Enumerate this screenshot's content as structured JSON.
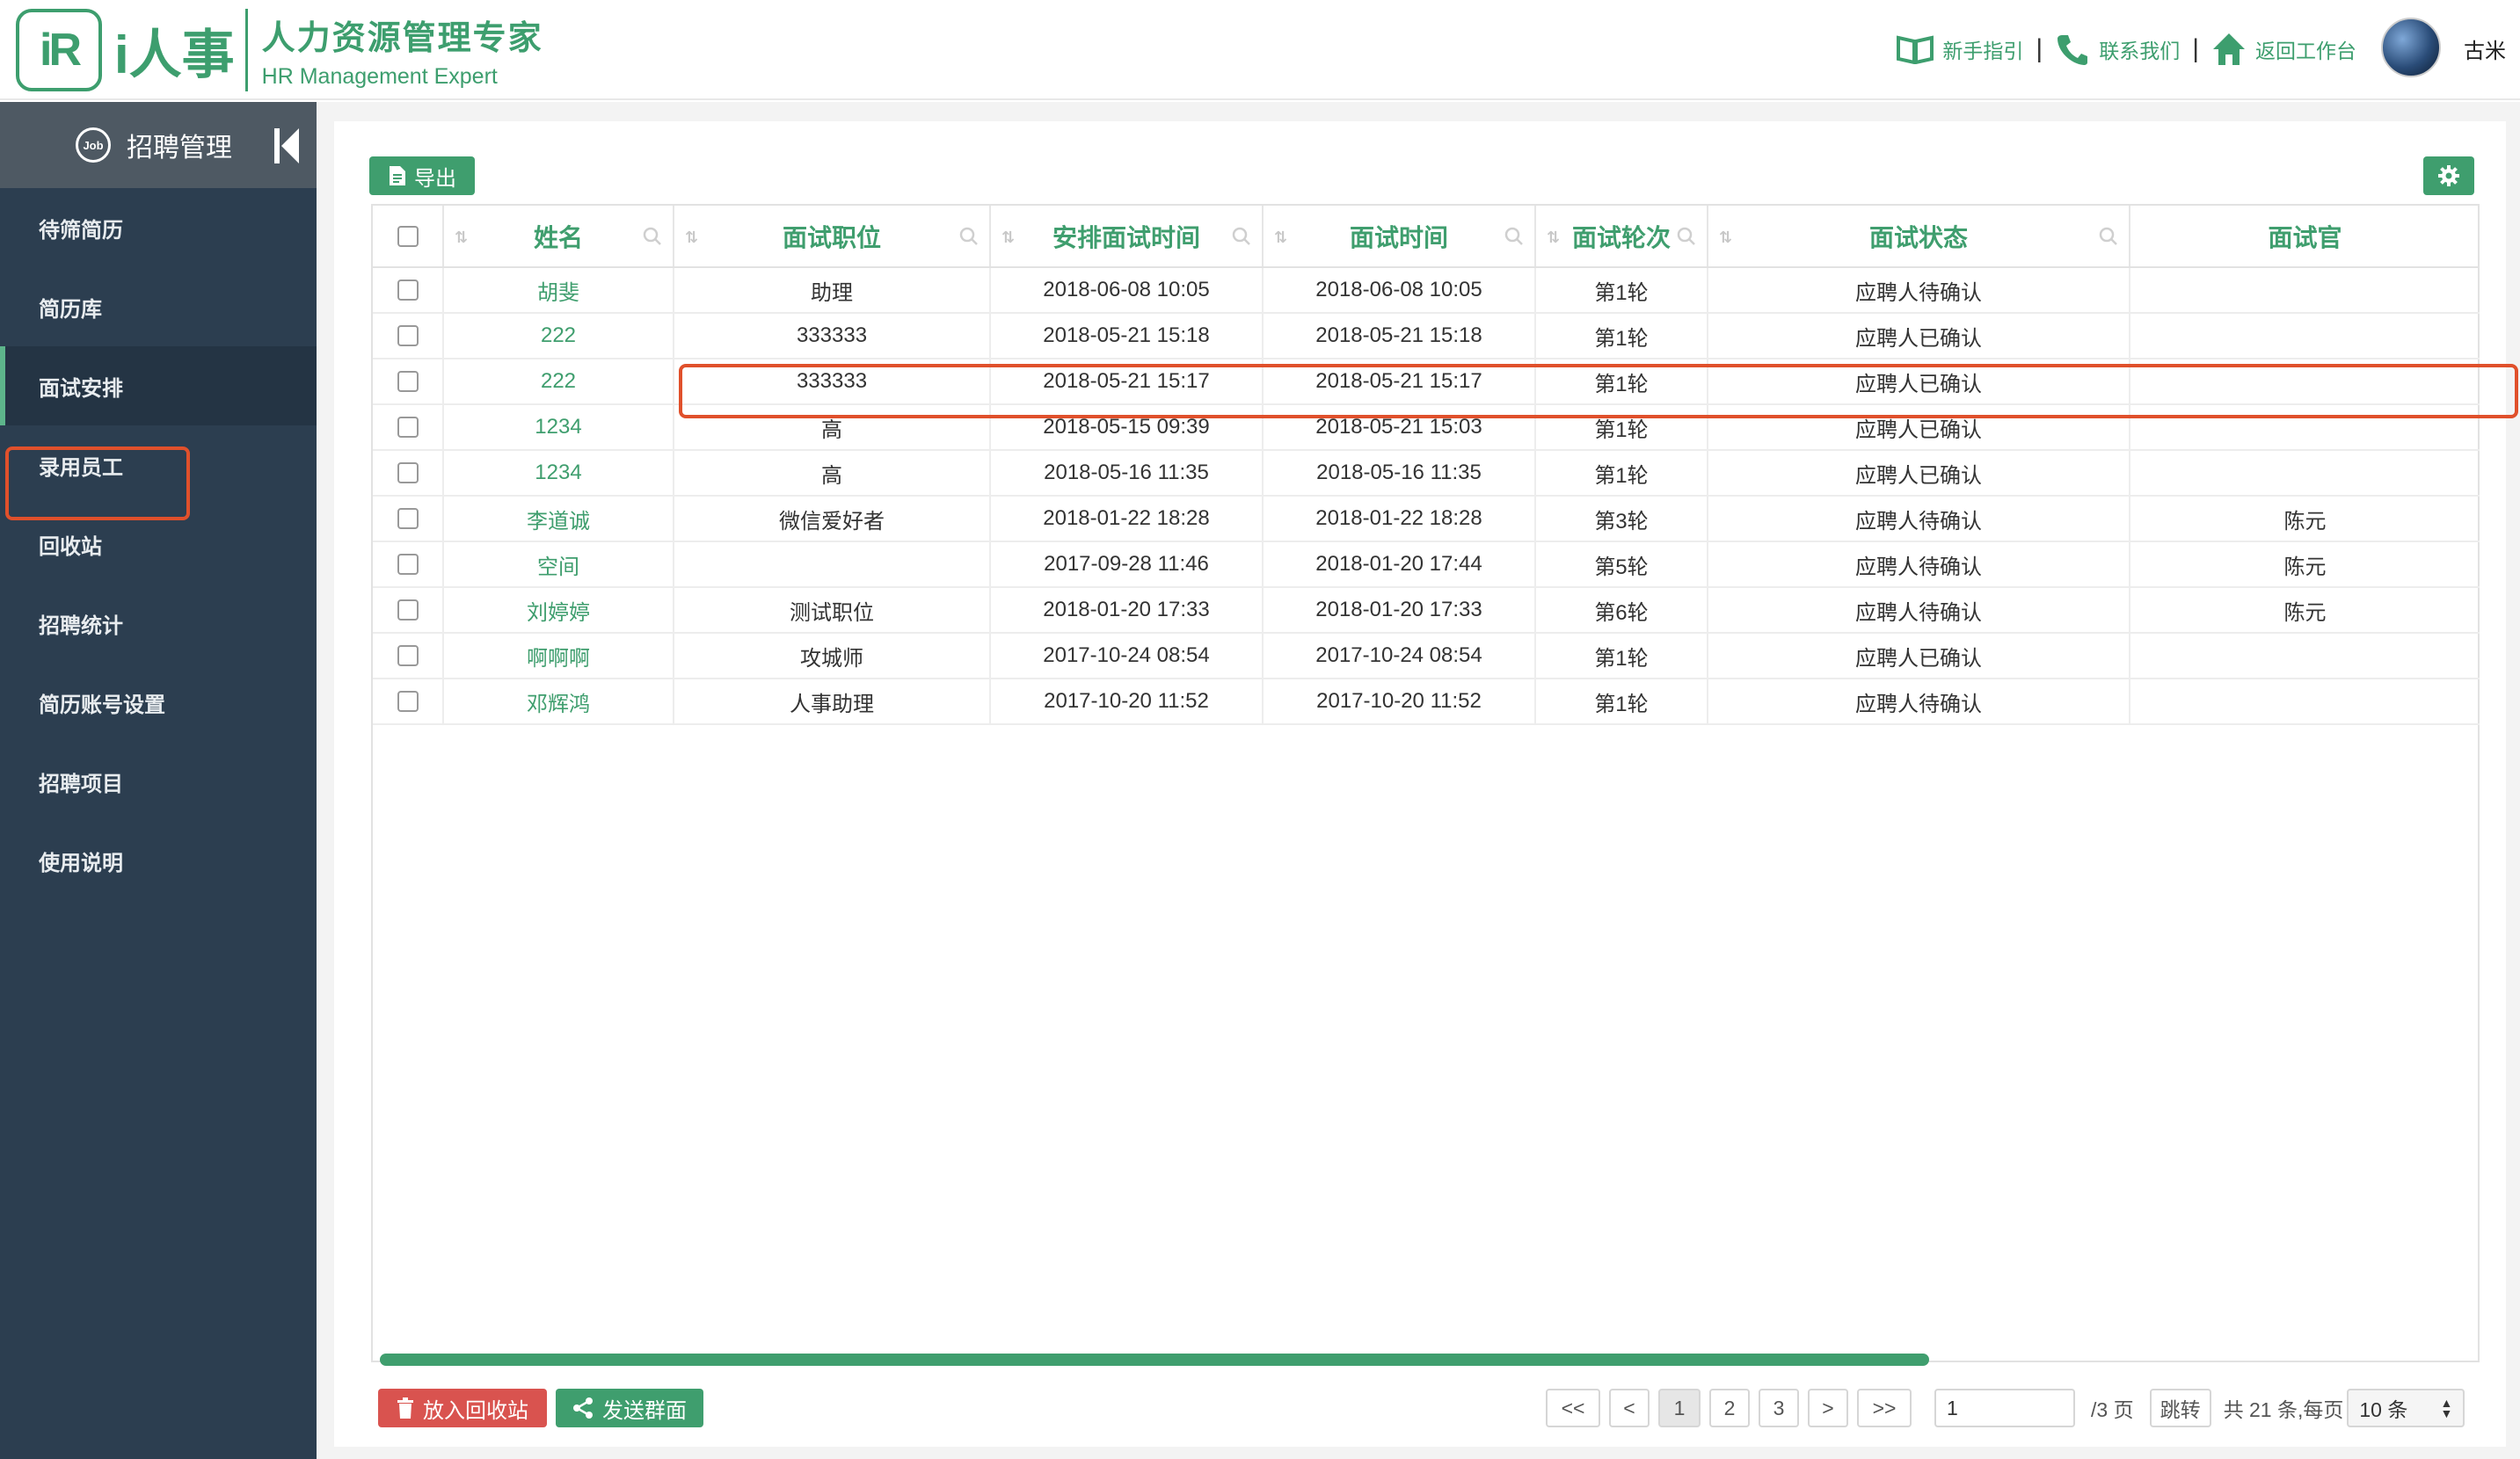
{
  "brand": {
    "logo_hr": "iR",
    "logo_iren": "i人事",
    "title_cn": "人力资源管理专家",
    "title_en": "HR Management Expert"
  },
  "top_nav": {
    "guide": "新手指引",
    "contact": "联系我们",
    "workbench": "返回工作台",
    "separator": "|",
    "username": "古米"
  },
  "sidebar": {
    "header": "招聘管理",
    "header_icon_text": "Job",
    "items": [
      {
        "label": "待筛简历"
      },
      {
        "label": "简历库"
      },
      {
        "label": "面试安排",
        "active": true
      },
      {
        "label": "录用员工"
      },
      {
        "label": "回收站"
      },
      {
        "label": "招聘统计"
      },
      {
        "label": "简历账号设置"
      },
      {
        "label": "招聘项目"
      },
      {
        "label": "使用说明"
      }
    ]
  },
  "toolbar": {
    "export_label": "导出"
  },
  "table": {
    "columns": [
      "姓名",
      "面试职位",
      "安排面试时间",
      "面试时间",
      "面试轮次",
      "面试状态",
      "面试官"
    ],
    "rows": [
      [
        "胡斐",
        "助理",
        "2018-06-08 10:05",
        "2018-06-08 10:05",
        "第1轮",
        "应聘人待确认",
        ""
      ],
      [
        "222",
        "333333",
        "2018-05-21 15:18",
        "2018-05-21 15:18",
        "第1轮",
        "应聘人已确认",
        ""
      ],
      [
        "222",
        "333333",
        "2018-05-21 15:17",
        "2018-05-21 15:17",
        "第1轮",
        "应聘人已确认",
        ""
      ],
      [
        "1234",
        "高",
        "2018-05-15 09:39",
        "2018-05-21 15:03",
        "第1轮",
        "应聘人已确认",
        ""
      ],
      [
        "1234",
        "高",
        "2018-05-16 11:35",
        "2018-05-16 11:35",
        "第1轮",
        "应聘人已确认",
        ""
      ],
      [
        "李道诚",
        "微信爱好者",
        "2018-01-22 18:28",
        "2018-01-22 18:28",
        "第3轮",
        "应聘人待确认",
        "陈元"
      ],
      [
        "空间",
        "",
        "2017-09-28 11:46",
        "2018-01-20 17:44",
        "第5轮",
        "应聘人待确认",
        "陈元"
      ],
      [
        "刘婷婷",
        "测试职位",
        "2018-01-20 17:33",
        "2018-01-20 17:33",
        "第6轮",
        "应聘人待确认",
        "陈元"
      ],
      [
        "啊啊啊",
        "攻城师",
        "2017-10-24 08:54",
        "2017-10-24 08:54",
        "第1轮",
        "应聘人已确认",
        ""
      ],
      [
        "邓辉鸿",
        "人事助理",
        "2017-10-20 11:52",
        "2017-10-20 11:52",
        "第1轮",
        "应聘人待确认",
        ""
      ]
    ]
  },
  "footer": {
    "recycle_label": "放入回收站",
    "send_label": "发送群面"
  },
  "pagination": {
    "first": "<<",
    "prev": "<",
    "pages": [
      "1",
      "2",
      "3"
    ],
    "current_page": "1",
    "next": ">",
    "last": ">>",
    "input_value": "1",
    "total_pages_text": "/3 页",
    "jump_label": "跳转",
    "summary_text": "共 21 条,每页",
    "page_size": "10 条"
  },
  "colors": {
    "accent": "#3f9e6e",
    "sidebar_bg": "#2c3e50",
    "danger": "#d9534f",
    "highlight": "#e0502b"
  }
}
